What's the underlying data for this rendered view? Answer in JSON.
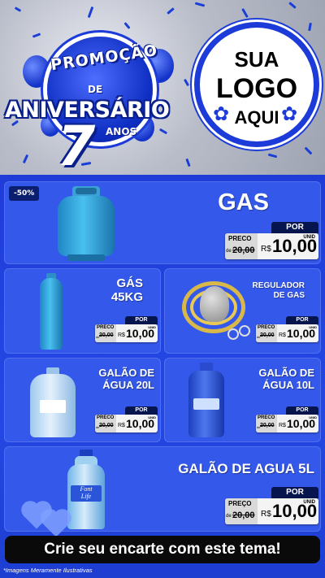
{
  "header": {
    "promo_word": "PROMOÇÃO",
    "de_word": "DE",
    "anniversary_word": "ANIVERSÁRIO",
    "number": "7",
    "anos_word": "ANOS",
    "logo": {
      "line1": "SUA",
      "line2": "LOGO",
      "line3": "AQUI"
    }
  },
  "products": [
    {
      "title": "GAS",
      "discount_badge": "-50%",
      "price_label": "PRECO",
      "por_label": "POR",
      "old_price": "20,00",
      "de_label": "de",
      "currency": "R$",
      "price": "10,00",
      "unit": "UNID"
    },
    {
      "title_line1": "GÁS",
      "title_line2": "45KG",
      "price_label": "PRECO",
      "por_label": "POR",
      "old_price": "20,00",
      "de_label": "de",
      "currency": "R$",
      "price": "10,00",
      "unit": "UNID"
    },
    {
      "title_line1": "REGULADOR",
      "title_line2": "DE GAS",
      "price_label": "PRECO",
      "por_label": "POR",
      "old_price": "20,00",
      "de_label": "de",
      "currency": "R$",
      "price": "10,00",
      "unit": "UNID"
    },
    {
      "title_line1": "GALÃO DE",
      "title_line2": "ÁGUA 20L",
      "price_label": "PRECO",
      "por_label": "POR",
      "old_price": "20,00",
      "de_label": "de",
      "currency": "R$",
      "price": "10,00",
      "unit": "UNID"
    },
    {
      "title_line1": "GALÃO DE",
      "title_line2": "ÁGUA 10L",
      "price_label": "PRECO",
      "por_label": "POR",
      "old_price": "20,00",
      "de_label": "de",
      "currency": "R$",
      "price": "10,00",
      "unit": "UNID"
    },
    {
      "title": "GALÃO DE AGUA 5L",
      "price_label": "PREÇO",
      "por_label": "POR",
      "old_price": "20,00",
      "de_label": "de",
      "currency": "R$",
      "price": "10,00",
      "unit": "UNID"
    }
  ],
  "bottle_brand": {
    "line1": "Font",
    "line2": "Life"
  },
  "banner_text": "Crie seu encarte com este tema!",
  "footnote": "*Imagens Meramente Ilustrativas",
  "colors": {
    "panel_blue": "#1f3cd8",
    "card_blue": "#3458ea",
    "tag_navy": "#07154f",
    "banner_black": "#0a0a0a"
  }
}
